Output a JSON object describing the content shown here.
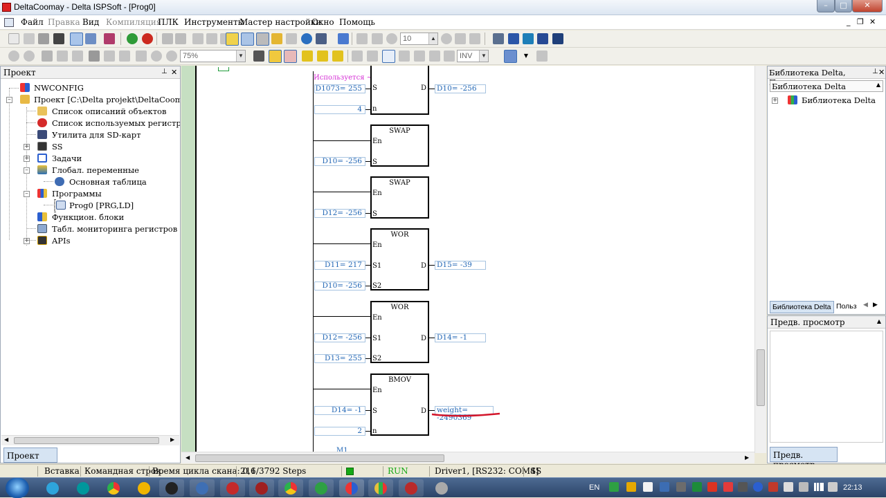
{
  "window": {
    "title": "DeltaCoomay - Delta ISPSoft - [Prog0]"
  },
  "menu": [
    "Файл",
    "Правка",
    "Вид",
    "Компиляция",
    "ПЛК",
    "Инструменты",
    "Мастер настройки",
    "Окно",
    "Помощь"
  ],
  "toolbar": {
    "step_value": "10",
    "zoom_value": "75%",
    "contact_type": "INV"
  },
  "project_panel": {
    "title": "Проект",
    "tab": "Проект",
    "tree": [
      "NWCONFIG",
      "Проект [C:\\Delta projekt\\DeltaCoomay\\Delta",
      "Список описаний объектов",
      "Список используемых регистров",
      "Утилита для SD-карт",
      "SS",
      "Задачи",
      "Глобал. переменные",
      "Основная таблица",
      "Программы",
      "Prog0 [PRG,LD]",
      "Функцион. блоки",
      "Табл. мониторинга регистров",
      "APIs"
    ]
  },
  "ladder": {
    "comment": "Используется ~",
    "top_block": {
      "s": "D1073= 255",
      "n": "4",
      "d": "D10= -256",
      "pin_s": "S",
      "pin_n": "n",
      "pin_d": "D"
    },
    "blocks": [
      {
        "name": "SWAP",
        "en": "En",
        "s": "D10= -256",
        "pin_s": "S"
      },
      {
        "name": "SWAP",
        "en": "En",
        "s": "D12= -256",
        "pin_s": "S"
      },
      {
        "name": "WOR",
        "en": "En",
        "s1": "D11= 217",
        "s2": "D10= -256",
        "d": "D15= -39",
        "pin_s1": "S1",
        "pin_s2": "S2",
        "pin_d": "D"
      },
      {
        "name": "WOR",
        "en": "En",
        "s1": "D12= -256",
        "s2": "D13= 255",
        "d": "D14= -1",
        "pin_s1": "S1",
        "pin_s2": "S2",
        "pin_d": "D"
      },
      {
        "name": "BMOV",
        "en": "En",
        "s": "D14= -1",
        "n": "2",
        "d": "weight= -2490369",
        "pin_s": "S",
        "pin_n": "n",
        "pin_d": "D"
      }
    ],
    "next_label": "M1"
  },
  "library_panel": {
    "title": "Библиотека Delta, Предв....",
    "subtitle": "Библиотека Delta",
    "tree_item": "Библиотека Delta",
    "tab1": "Библиотека Delta",
    "tab2": "Польз"
  },
  "preview_panel": {
    "title": "Предв. просмотр",
    "tab": "Предв. просмотр"
  },
  "status": {
    "insert": "Вставка",
    "cmd": "Командная строк",
    "scan": "Время цикла скана: 0,6",
    "steps": "211/3792 Steps",
    "run": "RUN",
    "driver": "Driver1, [RS232: COM4]",
    "ss": "SS"
  },
  "taskbar": {
    "lang": "EN",
    "time": "22:13"
  },
  "colors": {
    "accent_blue": "#2166b5",
    "comment_magenta": "#d42bd4",
    "highlight_red": "#d3152a",
    "run_green": "#15a815"
  }
}
